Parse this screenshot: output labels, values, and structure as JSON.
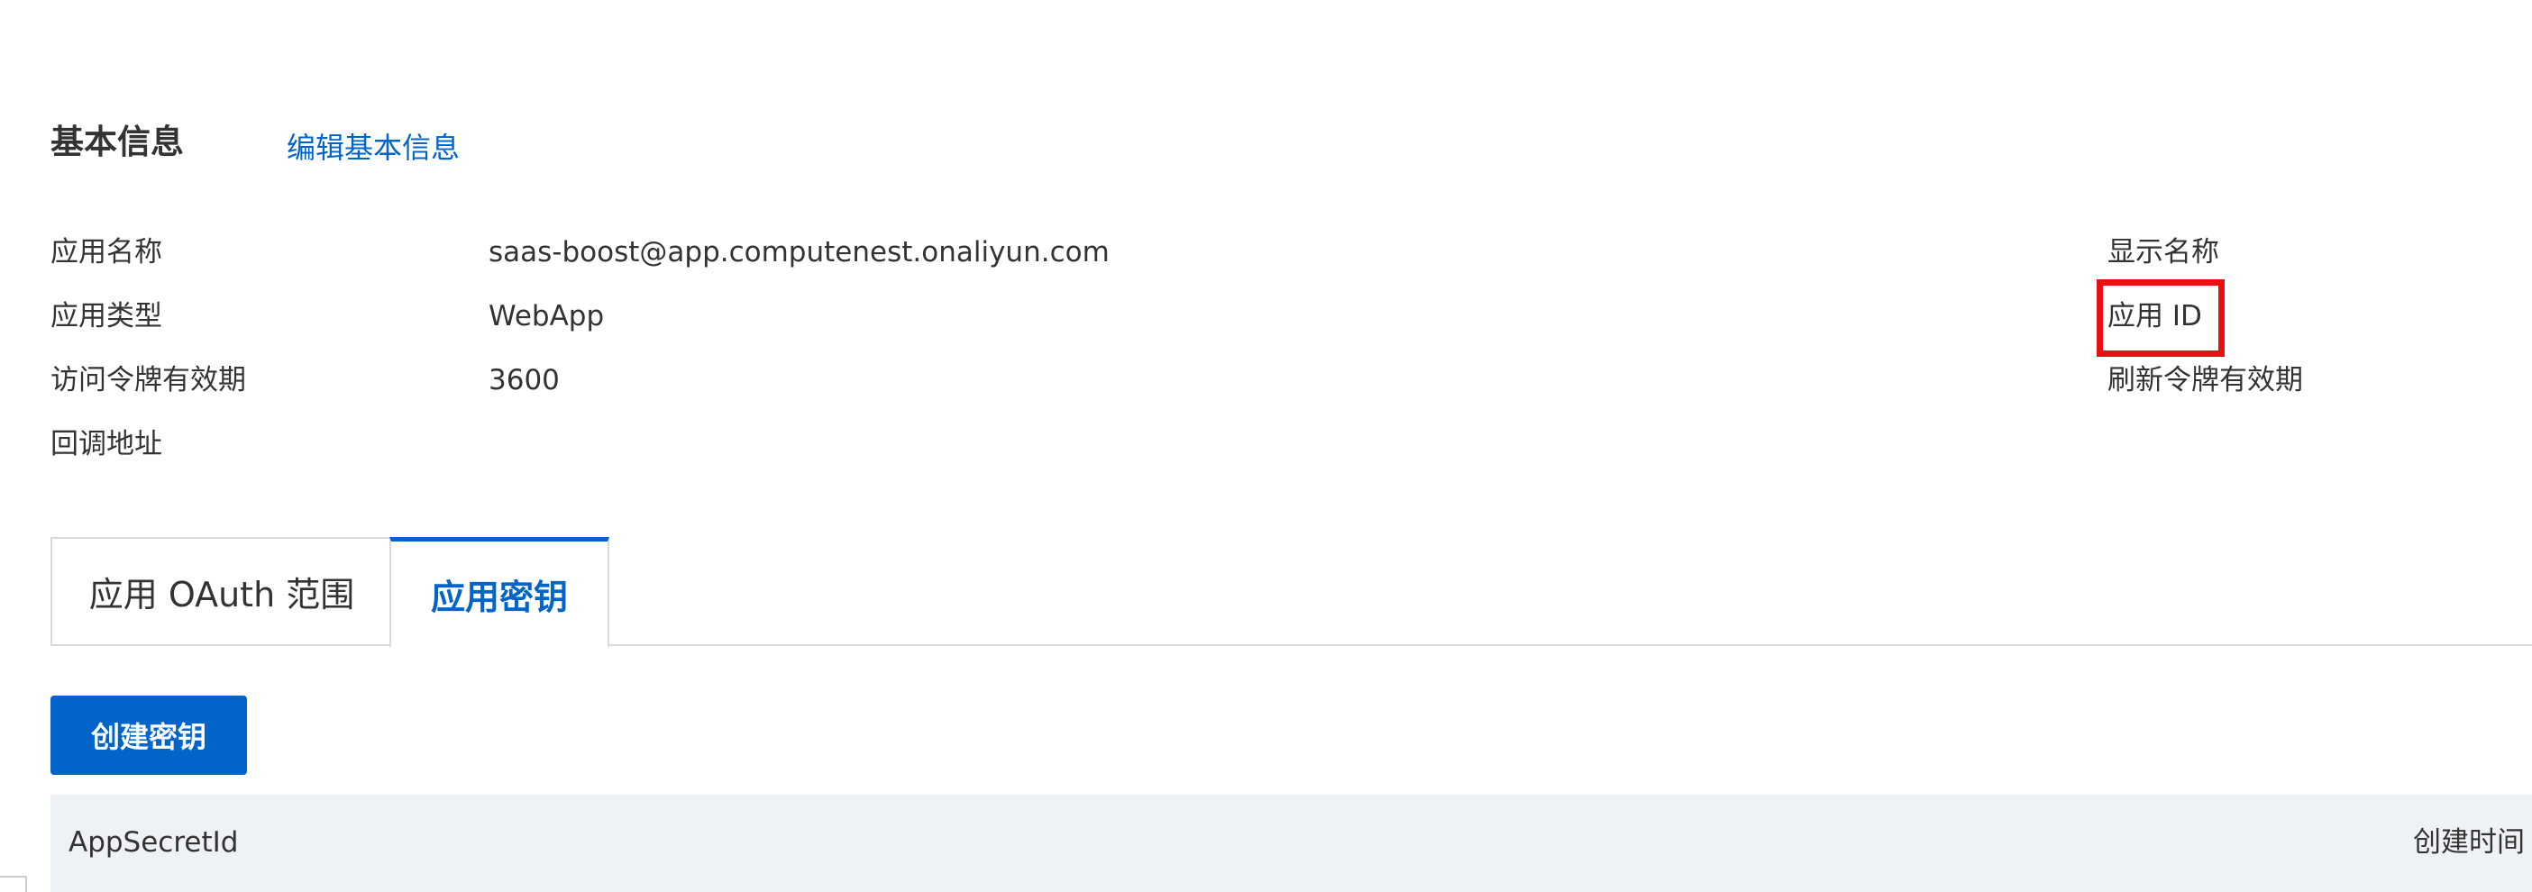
{
  "basic_info": {
    "title": "基本信息",
    "edit_link": "编辑基本信息",
    "fields": [
      {
        "label": "应用名称",
        "value": "saas-boost@app.computenest.onaliyun.com"
      },
      {
        "label": "应用类型",
        "value": "WebApp"
      },
      {
        "label": "访问令牌有效期",
        "value": "3600"
      },
      {
        "label": "回调地址",
        "value": ""
      }
    ],
    "right_fields": [
      {
        "label": "显示名称"
      },
      {
        "label": "应用 ID"
      },
      {
        "label": "刷新令牌有效期"
      }
    ]
  },
  "tabs": [
    {
      "label": "应用 OAuth 范围",
      "active": false
    },
    {
      "label": "应用密钥",
      "active": true
    }
  ],
  "actions": {
    "create_secret": "创建密钥"
  },
  "table": {
    "columns": [
      "AppSecretId",
      "创建时间"
    ]
  },
  "colors": {
    "accent": "#0064c8",
    "highlight": "#e8110f",
    "table_header_bg": "#eef1f5"
  }
}
